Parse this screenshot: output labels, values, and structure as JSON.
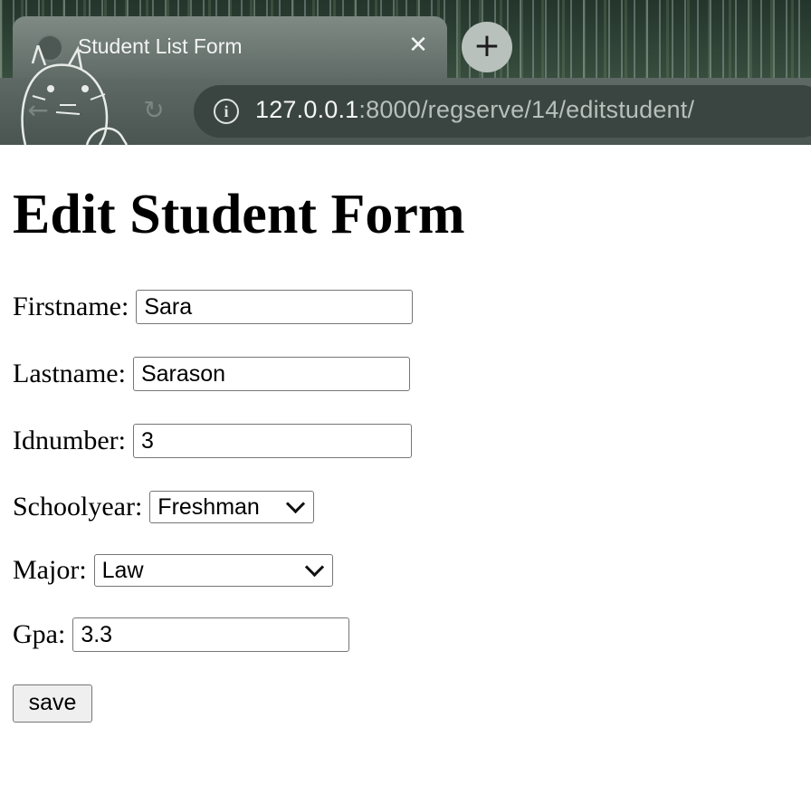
{
  "browser": {
    "tab_title": "Student List Form",
    "tab_close": "✕",
    "new_tab": "+",
    "url_host": "127.0.0.1",
    "url_rest": ":8000/regserve/14/editstudent/"
  },
  "form": {
    "heading": "Edit Student Form",
    "firstname_label": "Firstname:",
    "firstname_value": "Sara",
    "lastname_label": "Lastname:",
    "lastname_value": "Sarason",
    "idnumber_label": "Idnumber:",
    "idnumber_value": "3",
    "schoolyear_label": "Schoolyear:",
    "schoolyear_value": "Freshman",
    "major_label": "Major:",
    "major_value": "Law",
    "gpa_label": "Gpa:",
    "gpa_value": "3.3",
    "save_label": "save"
  },
  "icons": [
    "back-arrow-icon",
    "reload-icon",
    "info-icon",
    "close-icon",
    "plus-icon",
    "favicon-icon",
    "chevron-down-icon"
  ]
}
